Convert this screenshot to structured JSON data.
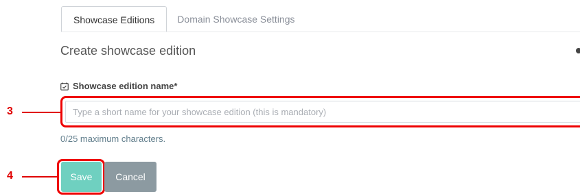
{
  "tabs": [
    {
      "label": "Showcase Editions",
      "active": true
    },
    {
      "label": "Domain Showcase Settings",
      "active": false
    }
  ],
  "page_title": "Create showcase edition",
  "field": {
    "label": "Showcase edition name*",
    "placeholder": "Type a short name for your showcase edition (this is mandatory)",
    "value": "",
    "counter": "0/25 maximum characters."
  },
  "buttons": {
    "save": "Save",
    "cancel": "Cancel"
  },
  "callouts": {
    "step_input": "3",
    "step_save": "4"
  },
  "colors": {
    "accent_save": "#6fd0c0",
    "cancel": "#8c9aa1",
    "callout_red": "#e00000"
  },
  "icons": {
    "field_label": "calendar-check-icon"
  }
}
